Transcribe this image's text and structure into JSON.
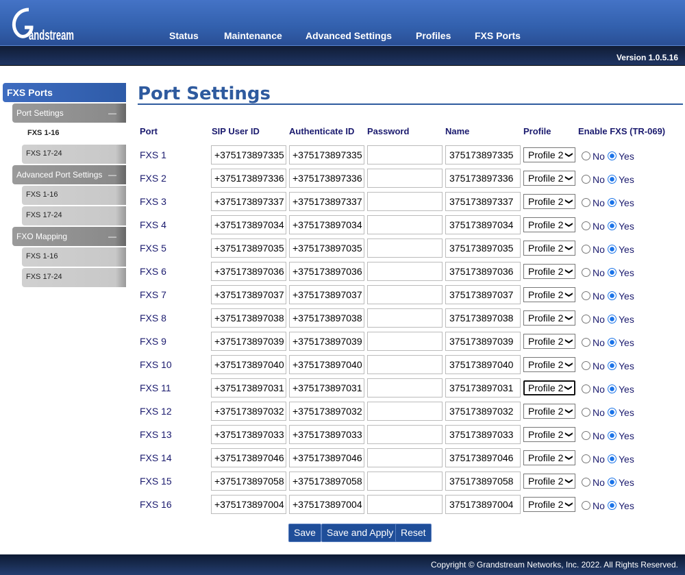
{
  "header": {
    "logo_text": "Grandstream",
    "nav": [
      "Status",
      "Maintenance",
      "Advanced Settings",
      "Profiles",
      "FXS Ports"
    ],
    "version": "Version 1.0.5.16"
  },
  "sidebar": {
    "title": "FXS Ports",
    "groups": [
      {
        "label": "Port Settings",
        "toggle": "—",
        "items": [
          "FXS 1-16",
          "FXS 17-24"
        ]
      },
      {
        "label": "Advanced Port Settings",
        "toggle": "—",
        "items": [
          "FXS 1-16",
          "FXS 17-24"
        ]
      },
      {
        "label": "FXO Mapping",
        "toggle": "—",
        "items": [
          "FXS 1-16",
          "FXS 17-24"
        ]
      }
    ],
    "active": "FXS 1-16"
  },
  "main": {
    "title": "Port Settings",
    "columns": [
      "Port",
      "SIP User ID",
      "Authenticate ID",
      "Password",
      "Name",
      "Profile",
      "Enable FXS (TR-069)"
    ],
    "radio_no": "No",
    "radio_yes": "Yes",
    "rows": [
      {
        "port": "FXS 1",
        "sip": "+375173897335",
        "auth": "+375173897335",
        "password": "",
        "name": "375173897335",
        "profile": "Profile 2",
        "enabled": true
      },
      {
        "port": "FXS 2",
        "sip": "+375173897336",
        "auth": "+375173897336",
        "password": "",
        "name": "375173897336",
        "profile": "Profile 2",
        "enabled": true
      },
      {
        "port": "FXS 3",
        "sip": "+375173897337",
        "auth": "+375173897337",
        "password": "",
        "name": "375173897337",
        "profile": "Profile 2",
        "enabled": true
      },
      {
        "port": "FXS 4",
        "sip": "+375173897034",
        "auth": "+375173897034",
        "password": "",
        "name": "375173897034",
        "profile": "Profile 2",
        "enabled": true
      },
      {
        "port": "FXS 5",
        "sip": "+375173897035",
        "auth": "+375173897035",
        "password": "",
        "name": "375173897035",
        "profile": "Profile 2",
        "enabled": true
      },
      {
        "port": "FXS 6",
        "sip": "+375173897036",
        "auth": "+375173897036",
        "password": "",
        "name": "375173897036",
        "profile": "Profile 2",
        "enabled": true
      },
      {
        "port": "FXS 7",
        "sip": "+375173897037",
        "auth": "+375173897037",
        "password": "",
        "name": "375173897037",
        "profile": "Profile 2",
        "enabled": true
      },
      {
        "port": "FXS 8",
        "sip": "+375173897038",
        "auth": "+375173897038",
        "password": "",
        "name": "375173897038",
        "profile": "Profile 2",
        "enabled": true
      },
      {
        "port": "FXS 9",
        "sip": "+375173897039",
        "auth": "+375173897039",
        "password": "",
        "name": "375173897039",
        "profile": "Profile 2",
        "enabled": true
      },
      {
        "port": "FXS 10",
        "sip": "+375173897040",
        "auth": "+375173897040",
        "password": "",
        "name": "375173897040",
        "profile": "Profile 2",
        "enabled": true
      },
      {
        "port": "FXS 11",
        "sip": "+375173897031",
        "auth": "+375173897031",
        "password": "",
        "name": "375173897031",
        "profile": "Profile 2",
        "enabled": true,
        "focused": true
      },
      {
        "port": "FXS 12",
        "sip": "+375173897032",
        "auth": "+375173897032",
        "password": "",
        "name": "375173897032",
        "profile": "Profile 2",
        "enabled": true
      },
      {
        "port": "FXS 13",
        "sip": "+375173897033",
        "auth": "+375173897033",
        "password": "",
        "name": "375173897033",
        "profile": "Profile 2",
        "enabled": true
      },
      {
        "port": "FXS 14",
        "sip": "+375173897046",
        "auth": "+375173897046",
        "password": "",
        "name": "375173897046",
        "profile": "Profile 2",
        "enabled": true
      },
      {
        "port": "FXS 15",
        "sip": "+375173897058",
        "auth": "+375173897058",
        "password": "",
        "name": "375173897058",
        "profile": "Profile 2",
        "enabled": true
      },
      {
        "port": "FXS 16",
        "sip": "+375173897004",
        "auth": "+375173897004",
        "password": "",
        "name": "375173897004",
        "profile": "Profile 2",
        "enabled": true
      }
    ],
    "buttons": {
      "save": "Save",
      "save_apply": "Save and Apply",
      "reset": "Reset"
    }
  },
  "footer": {
    "copyright": "Copyright © Grandstream Networks, Inc. 2022. All Rights Reserved."
  }
}
